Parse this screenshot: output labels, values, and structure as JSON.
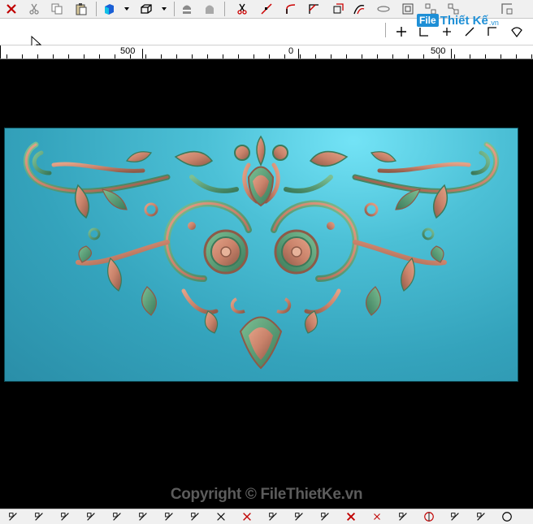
{
  "toolbar_top": {
    "icons": [
      "close-icon",
      "cut-icon",
      "copy-icon",
      "paste-icon",
      "cube-view-icon",
      "dropdown-arrow-icon",
      "box-view-icon",
      "dropdown-arrow-icon",
      "shade-icon",
      "shade-gray-icon",
      "scissors-icon",
      "line-icon",
      "arc-icon",
      "corner-icon",
      "offset-icon",
      "curve-icon",
      "ellipse-icon",
      "frame-icon",
      "nodes-icon",
      "nodes2-icon",
      "corner-frame-icon"
    ]
  },
  "toolbar_second": {
    "icons": [
      "plus-icon",
      "snap-icon",
      "break-icon",
      "trim-icon",
      "extend-icon",
      "fan-icon"
    ]
  },
  "watermark": {
    "box_text": "File",
    "text": "Thiết Kế",
    "suffix": ".vn"
  },
  "ruler": {
    "labels": [
      "500",
      "0",
      "500"
    ]
  },
  "footer": {
    "copyright": "Copyright © FileThietKe.vn"
  },
  "toolbar_bottom": {
    "icons": [
      "pen-icon",
      "select-node-icon",
      "move-icon",
      "diamond-icon",
      "diamond2-icon",
      "diamond3-icon",
      "axis-icon",
      "axis2-icon",
      "select-x-icon",
      "delete-x-icon",
      "transform-icon",
      "transform2-icon",
      "grid-icon",
      "close-red-icon",
      "cross-icon",
      "slash-icon",
      "target-icon",
      "check-icon",
      "pen2-icon",
      "circle-icon"
    ]
  },
  "colors": {
    "canvas_bg": "#3fb2c9",
    "carving_copper": "#c9826a",
    "carving_green": "#4f9a72",
    "background": "#000000"
  }
}
